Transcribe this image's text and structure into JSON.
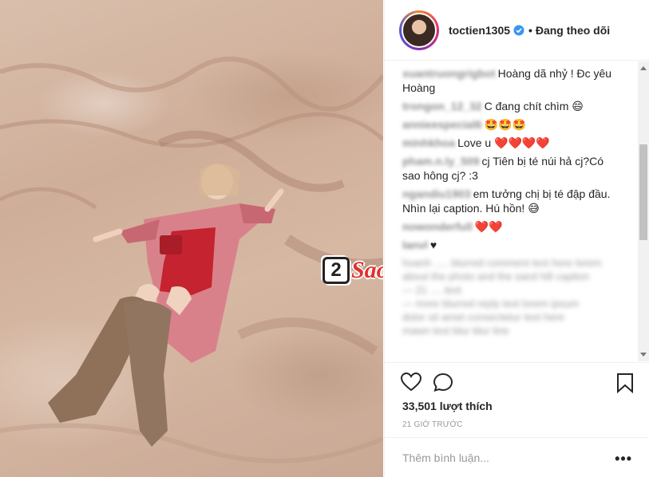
{
  "post": {
    "username": "toctien1305",
    "follow_status": "Đang theo dõi",
    "likes": "33,501 lượt thích",
    "time": "21 GIỜ TRƯỚC",
    "comment_placeholder": "Thêm bình luận...",
    "more_label": "•••"
  },
  "watermark": {
    "box": "2",
    "text": "Sao"
  },
  "comments": [
    {
      "name": "xuantruongrigbot",
      "text": "Hoàng dã nhỷ ! Đc yêu Hoàng"
    },
    {
      "name": "trongon_12_32",
      "text": "C đang chít chìm 😄"
    },
    {
      "name": "annieespecial6",
      "text": "🤩🤩🤩"
    },
    {
      "name": "minhkhoa",
      "text": "Love u ❤️❤️❤️❤️"
    },
    {
      "name": "pham.n.ly_509",
      "text": "cj Tiên bị té núi hả cj?Có sao hông cj? :3"
    },
    {
      "name": "ngandiu1903",
      "text": "em tưởng chị bị té đập đầu. Nhìn lại caption. Hú hồn! 😅"
    },
    {
      "name": "nowonderfull",
      "text": "❤️❤️"
    },
    {
      "name": "lanvl",
      "text": "♥"
    }
  ],
  "blurred_tail": [
    "hoanh ..... blurred comment text here lorem",
    "about the photo and the sand hill caption",
    "— 21 .... text",
    "— more blurred reply text lorem ipsum",
    "dolor sit amet consectetur text here",
    "mawn text blur blur line"
  ],
  "colors": {
    "verified": "#3897f0",
    "heart": "#e0245e",
    "accent": "#e0322f"
  }
}
